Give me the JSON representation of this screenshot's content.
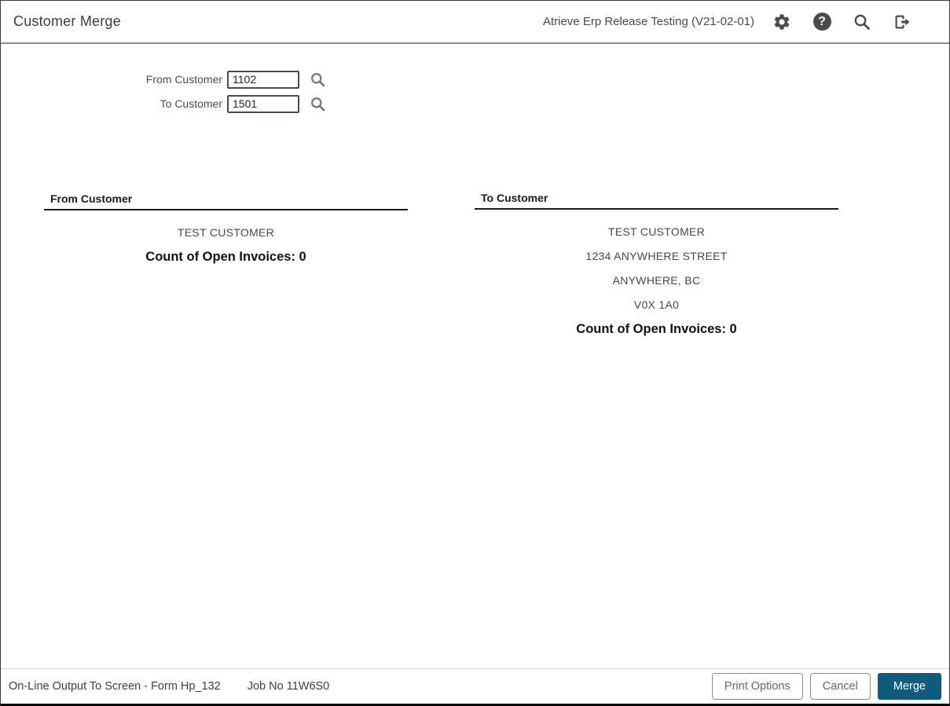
{
  "header": {
    "title": "Customer Merge",
    "environment": "Atrieve Erp Release Testing (V21-02-01)",
    "icons": {
      "settings": "settings-gear-icon",
      "help": "help-icon",
      "help_glyph": "?",
      "search": "search-icon",
      "logout": "logout-icon"
    }
  },
  "form": {
    "fields": [
      {
        "label": "From Customer",
        "value": "1102",
        "icon": "search-lookup-icon"
      },
      {
        "label": "To Customer",
        "value": "1501",
        "icon": "search-lookup-icon"
      }
    ]
  },
  "panels": {
    "from": {
      "header": "From Customer",
      "lines": [
        "TEST CUSTOMER"
      ],
      "count_label": "Count of Open Invoices: 0"
    },
    "to": {
      "header": "To Customer",
      "lines": [
        "TEST CUSTOMER",
        "1234 ANYWHERE STREET",
        "ANYWHERE, BC",
        "V0X 1A0"
      ],
      "count_label": "Count of Open Invoices: 0"
    }
  },
  "footer": {
    "status": "On-Line Output To Screen - Form Hp_132",
    "job": "Job No 11W6S0",
    "buttons": {
      "print_options": "Print Options",
      "cancel": "Cancel",
      "merge": "Merge"
    }
  },
  "colors": {
    "accent": "#0F5C7E",
    "icon": "#4A4A4A",
    "input_border": "#414E5A",
    "header_border": "#8C8C8C"
  }
}
